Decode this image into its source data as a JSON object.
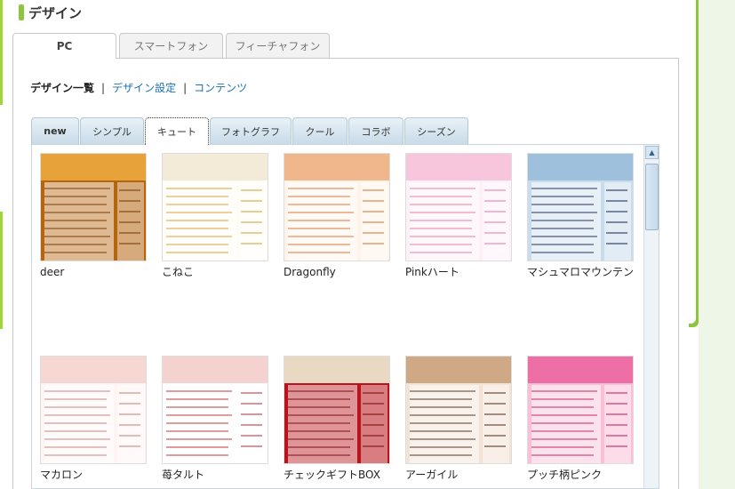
{
  "page": {
    "title": "デザイン"
  },
  "top_tabs": [
    {
      "label": "PC",
      "active": true
    },
    {
      "label": "スマートフォン",
      "active": false
    },
    {
      "label": "フィーチャフォン",
      "active": false
    }
  ],
  "subnav": {
    "current": "デザイン一覧",
    "separator": "|",
    "links": [
      "デザイン設定",
      "コンテンツ"
    ]
  },
  "category_tabs": [
    {
      "label": "new"
    },
    {
      "label": "シンプル"
    },
    {
      "label": "キュート",
      "active": true
    },
    {
      "label": "フォトグラフ"
    },
    {
      "label": "クール"
    },
    {
      "label": "コラボ"
    },
    {
      "label": "シーズン"
    }
  ],
  "designs": [
    {
      "name": "deer",
      "colors": {
        "bg": "#b5650d",
        "header": "#e8a23a",
        "accent": "#7a3d05"
      }
    },
    {
      "name": "こねこ",
      "colors": {
        "bg": "#fffdf6",
        "header": "#f3ead8",
        "accent": "#d9a441"
      }
    },
    {
      "name": "Dragonfly",
      "colors": {
        "bg": "#fff3ea",
        "header": "#f0b78c",
        "accent": "#d57a3e"
      }
    },
    {
      "name": "Pinkハート",
      "colors": {
        "bg": "#fff0f7",
        "header": "#f7c6dd",
        "accent": "#e87fb0"
      }
    },
    {
      "name": "マシュマロマウンテン",
      "colors": {
        "bg": "#c9dced",
        "header": "#9fc0dd",
        "accent": "#26345e"
      }
    },
    {
      "name": "マカロン",
      "colors": {
        "bg": "#fff6f4",
        "header": "#f6d7d3",
        "accent": "#c9877f"
      }
    },
    {
      "name": "苺タルト",
      "colors": {
        "bg": "#ffffff",
        "header": "#f4d2d0",
        "accent": "#c0393f"
      }
    },
    {
      "name": "チェックギフトBOX",
      "colors": {
        "bg": "#b8141b",
        "header": "#e9d9c3",
        "accent": "#7c0d11"
      }
    },
    {
      "name": "アーガイル",
      "colors": {
        "bg": "#f2e3d5",
        "header": "#cfa986",
        "accent": "#5c3a26"
      }
    },
    {
      "name": "プッチ柄ピンク",
      "colors": {
        "bg": "#f8bfd6",
        "header": "#ee6fa6",
        "accent": "#c4276b"
      }
    }
  ],
  "scrollbar": {
    "up_arrow": "▲"
  }
}
